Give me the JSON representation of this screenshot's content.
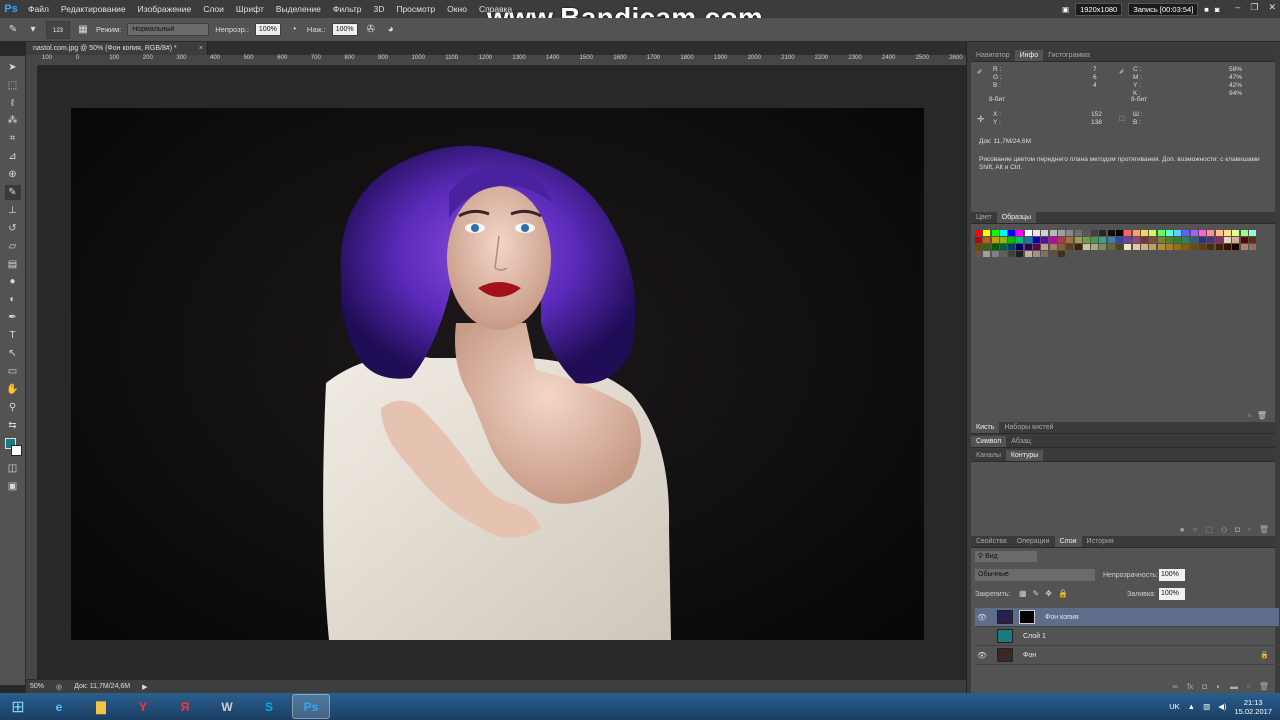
{
  "app": {
    "logo": "Ps",
    "watermark": "www.Bandicam.com"
  },
  "menu": [
    "Файл",
    "Редактирование",
    "Изображение",
    "Слои",
    "Шрифт",
    "Выделение",
    "Фильтр",
    "3D",
    "Просмотр",
    "Окно",
    "Справка"
  ],
  "recording": {
    "resolution": "1920x1080",
    "status": "Запись [00:03:54]"
  },
  "options": {
    "brush_size": "123",
    "mode_label": "Режим:",
    "mode_value": "Нормальный",
    "opacity_label": "Непрозр.:",
    "opacity_value": "100%",
    "pressure_label": "Наж.:",
    "pressure_value": "100%"
  },
  "colors": {
    "foreground": "#1a7a80",
    "background": "#ffffff",
    "accent": "#31a8ff"
  },
  "document": {
    "tab_title": "nastol.com.jpg @ 50% (Фон копия, RGB/8#) *",
    "ruler_ticks": [
      "100",
      "0",
      "100",
      "200",
      "300",
      "400",
      "500",
      "600",
      "700",
      "800",
      "900",
      "1000",
      "1100",
      "1200",
      "1300",
      "1400",
      "1500",
      "1600",
      "1700",
      "1800",
      "1900",
      "2000",
      "2100",
      "2200",
      "2300",
      "2400",
      "2500",
      "2600"
    ],
    "zoom": "50%",
    "doc_size": "Док: 11,7M/24,6M"
  },
  "info_panel": {
    "tabs": [
      "Навигатор",
      "Инфо",
      "Гистограмма"
    ],
    "active_tab": "Инфо",
    "rgb": {
      "r_label": "R :",
      "g_label": "G :",
      "b_label": "B :",
      "r": "7",
      "g": "6",
      "b": "4"
    },
    "cmyk": {
      "c_label": "C :",
      "m_label": "M :",
      "y_label": "Y :",
      "k_label": "K :",
      "c": "58%",
      "m": "47%",
      "y": "42%",
      "k": "94%"
    },
    "bits_left": "8-бит",
    "bits_right": "8-бит",
    "xy": {
      "x_label": "X :",
      "y_label": "Y :",
      "x": "152",
      "y": "138"
    },
    "wh": {
      "w_label": "Ш :",
      "h_label": "В :"
    },
    "doc": "Док: 11,7M/24,6M",
    "hint": "Рисование цветом переднего плана методом протягивания. Доп. возможности: с клавишами Shift, Alt и Ctrl."
  },
  "swatches_panel": {
    "tabs": [
      "Цвет",
      "Образцы"
    ],
    "active_tab": "Образцы",
    "colors": [
      "#ff0000",
      "#ffff00",
      "#00ff00",
      "#00ffff",
      "#0000ff",
      "#ff00ff",
      "#ffffff",
      "#e6e6e6",
      "#d0d0d0",
      "#b8b8b8",
      "#a0a0a0",
      "#888888",
      "#707070",
      "#585858",
      "#404040",
      "#282828",
      "#101010",
      "#000000",
      "#ff6060",
      "#ffa060",
      "#ffd060",
      "#d0ff60",
      "#60ff60",
      "#60ffd0",
      "#60d0ff",
      "#6060ff",
      "#a060ff",
      "#ff60d0",
      "#ff9090",
      "#ffc090",
      "#ffe090",
      "#e0ff90",
      "#90ff90",
      "#90ffe0",
      "#c00000",
      "#c06000",
      "#c0a000",
      "#80c000",
      "#00c000",
      "#00c080",
      "#0080c0",
      "#0000c0",
      "#6000c0",
      "#c000a0",
      "#a04040",
      "#a07040",
      "#a0a040",
      "#70a040",
      "#40a040",
      "#40a080",
      "#4080a0",
      "#4040a0",
      "#7040a0",
      "#a04080",
      "#803030",
      "#805030",
      "#808030",
      "#508030",
      "#308030",
      "#308060",
      "#306080",
      "#303080",
      "#503080",
      "#803060",
      "#e8d0b0",
      "#d0b090",
      "#600000",
      "#603000",
      "#605000",
      "#406000",
      "#006000",
      "#006040",
      "#004060",
      "#000060",
      "#300060",
      "#600050",
      "#c0a080",
      "#a08060",
      "#806040",
      "#604020",
      "#402010",
      "#c8c8a0",
      "#a8a880",
      "#888860",
      "#686840",
      "#484820",
      "#f0e0c0",
      "#e0c8a0",
      "#d0b080",
      "#c0a060",
      "#b09040",
      "#a08030",
      "#907020",
      "#806010",
      "#705000",
      "#604000",
      "#503000",
      "#402000",
      "#301000",
      "#200000",
      "#b08070",
      "#907060",
      "#705040",
      "#a0a0a0",
      "#808080",
      "#606060",
      "#404040",
      "#202020",
      "#c0b0a0",
      "#a09080",
      "#807060",
      "#605040",
      "#403020"
    ]
  },
  "brush_panel": {
    "tabs": [
      "Кисть",
      "Наборы кистей"
    ],
    "active_tab": "Кисть"
  },
  "char_panel": {
    "tabs": [
      "Символ",
      "Абзац"
    ],
    "active_tab": "Символ"
  },
  "paths_panel": {
    "tabs": [
      "Каналы",
      "Контуры"
    ],
    "active_tab": "Контуры"
  },
  "layers_panel": {
    "tabs": [
      "Свойства",
      "Операции",
      "Слои",
      "История"
    ],
    "active_tab": "Слои",
    "filter_label": "Вид",
    "blend_mode": "Обычные",
    "opacity_label": "Непрозрачность:",
    "opacity": "100%",
    "lock_label": "Закрепить:",
    "fill_label": "Заливка:",
    "fill": "100%",
    "layers": [
      {
        "name": "Фон копия",
        "selected": true,
        "visible": true,
        "thumb": "#2a2050",
        "has_mask": true,
        "locked": false
      },
      {
        "name": "Слой 1",
        "selected": false,
        "visible": false,
        "thumb": "#1a7a80",
        "has_mask": false,
        "locked": false
      },
      {
        "name": "Фон",
        "selected": false,
        "visible": true,
        "thumb": "#3a2826",
        "has_mask": false,
        "locked": true
      }
    ]
  },
  "taskbar": {
    "apps": [
      {
        "name": "ie",
        "glyph": "e",
        "color": "#4fc3ff"
      },
      {
        "name": "explorer",
        "glyph": "▇",
        "color": "#f5c542"
      },
      {
        "name": "yandex-browser",
        "glyph": "Y",
        "color": "#ff3333"
      },
      {
        "name": "yandex",
        "glyph": "Я",
        "color": "#ff3333"
      },
      {
        "name": "world-of-tanks",
        "glyph": "W",
        "color": "#d0d0d0"
      },
      {
        "name": "skype",
        "glyph": "S",
        "color": "#00aff0"
      },
      {
        "name": "photoshop",
        "glyph": "Ps",
        "color": "#31a8ff"
      }
    ],
    "lang": "UK",
    "time": "21:13",
    "date": "15.02.2017"
  }
}
